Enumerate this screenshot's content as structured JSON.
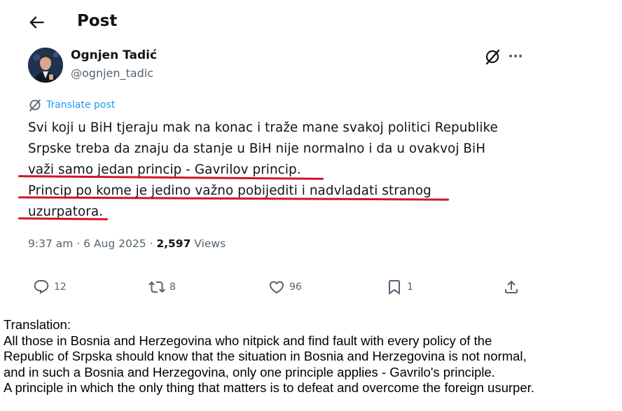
{
  "header": {
    "title": "Post"
  },
  "author": {
    "name": "Ognjen Tadić",
    "handle": "@ognjen_tadic"
  },
  "translate_label": "Translate post",
  "tweet_lines": [
    "Svi koji u BiH tjeraju mak na konac i traže mane svakoj politici Republike",
    "Srpske treba da znaju da stanje u BiH nije normalno i da u ovakvoj BiH",
    "važi samo jedan princip - Gavrilov princip.",
    "Princip po kome je jedino važno pobijediti i nadvladati stranog",
    "uzurpatora."
  ],
  "meta": {
    "time": "9:37 am",
    "sep1": " · ",
    "date": "6 Aug 2025",
    "sep2": " · ",
    "views_count": "2,597",
    "views_label": " Views"
  },
  "actions": {
    "replies": "12",
    "reposts": "8",
    "likes": "96",
    "bookmarks": "1"
  },
  "translation": [
    "Translation:",
    "All those in Bosnia and Herzegovina who nitpick and find fault with every policy of the",
    "Republic of Srpska should know that the situation in Bosnia and Herzegovina is not normal,",
    "and in such a Bosnia and Herzegovina, only one principle applies - Gavrilo's principle.",
    "A principle in which the only thing that matters is to defeat and overcome the foreign usurper."
  ],
  "colors": {
    "link": "#1d9bf0",
    "underline": "#d0152a",
    "muted": "#536471"
  },
  "icons": [
    "back-arrow-icon",
    "grok-icon",
    "more-icon",
    "translate-icon",
    "reply-icon",
    "repost-icon",
    "like-icon",
    "bookmark-icon",
    "share-icon"
  ]
}
